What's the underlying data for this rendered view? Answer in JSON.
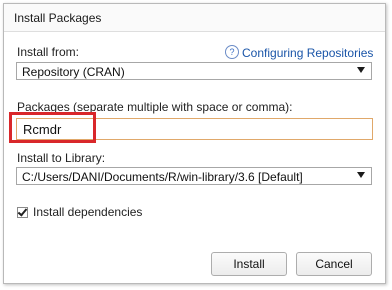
{
  "window": {
    "title": "Install Packages"
  },
  "install_from": {
    "label": "Install from:",
    "help_icon": "?",
    "help_link": "Configuring Repositories",
    "selected": "Repository (CRAN)"
  },
  "packages": {
    "label": "Packages (separate multiple with space or comma):",
    "value": "Rcmdr"
  },
  "library": {
    "label": "Install to Library:",
    "selected": "C:/Users/DANI/Documents/R/win-library/3.6 [Default]"
  },
  "dependencies": {
    "label": "Install dependencies",
    "checked": true
  },
  "buttons": {
    "install": "Install",
    "cancel": "Cancel"
  },
  "colors": {
    "highlight": "#d9272a",
    "link": "#1a55a8",
    "input_focus_border": "#e0a86a"
  },
  "icons": {
    "help": "question-circle-icon",
    "dropdown": "chevron-down-icon",
    "check": "checkmark-icon"
  }
}
